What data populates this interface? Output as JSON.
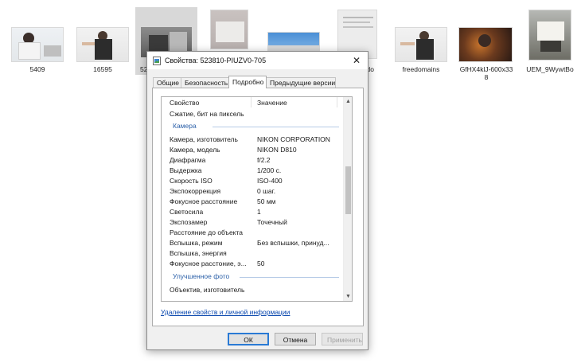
{
  "files": [
    {
      "name": "5409",
      "icon": "photo-thumbnail"
    },
    {
      "name": "16595",
      "icon": "photo-thumbnail"
    },
    {
      "name": "52",
      "icon": "photo-thumbnail"
    },
    {
      "name": "",
      "icon": "photo-thumbnail"
    },
    {
      "name": "",
      "icon": "photo-thumbnail"
    },
    {
      "name": "do",
      "icon": "photo-thumbnail"
    },
    {
      "name": "freedomains",
      "icon": "photo-thumbnail"
    },
    {
      "name": "GfHX4klJ-600x33\n8",
      "icon": "photo-thumbnail"
    },
    {
      "name": "UEM_9WywtBo",
      "icon": "photo-thumbnail"
    }
  ],
  "dialog": {
    "title": "Свойства: 523810-PIUZV0-705",
    "icon": "image-file-icon",
    "close_symbol": "✕",
    "tabs": [
      {
        "label": "Общие",
        "active": false
      },
      {
        "label": "Безопасность",
        "active": false
      },
      {
        "label": "Подробно",
        "active": true
      },
      {
        "label": "Предыдущие версии",
        "active": false
      }
    ],
    "columns": {
      "property": "Свойство",
      "value": "Значение"
    },
    "rows": [
      {
        "type": "row",
        "key": "Сжатие, бит на пиксель",
        "value": ""
      },
      {
        "type": "group",
        "label": "Камера"
      },
      {
        "type": "row",
        "key": "Камера, изготовитель",
        "value": "NIKON CORPORATION"
      },
      {
        "type": "row",
        "key": "Камера, модель",
        "value": "NIKON D810"
      },
      {
        "type": "row",
        "key": "Диафрагма",
        "value": "f/2.2"
      },
      {
        "type": "row",
        "key": "Выдержка",
        "value": "1/200 с."
      },
      {
        "type": "row",
        "key": "Скорость ISO",
        "value": "ISO-400"
      },
      {
        "type": "row",
        "key": "Экспокоррекция",
        "value": "0 шаг."
      },
      {
        "type": "row",
        "key": "Фокусное расстояние",
        "value": "50 мм"
      },
      {
        "type": "row",
        "key": "Светосила",
        "value": "1"
      },
      {
        "type": "row",
        "key": "Экспозамер",
        "value": "Точечный"
      },
      {
        "type": "row",
        "key": "Расстояние до объекта",
        "value": ""
      },
      {
        "type": "row",
        "key": "Вспышка, режим",
        "value": "Без вспышки, принуд..."
      },
      {
        "type": "row",
        "key": "Вспышка, энергия",
        "value": ""
      },
      {
        "type": "row",
        "key": "Фокусное расстоние, э...",
        "value": "50"
      },
      {
        "type": "group",
        "label": "Улучшенное фото"
      },
      {
        "type": "row",
        "key": "Объектив, изготовитель",
        "value": ""
      }
    ],
    "remove_link": "Удаление свойств и личной информации",
    "buttons": {
      "ok": "ОК",
      "cancel": "Отмена",
      "apply": "Применить"
    },
    "colors": {
      "group_header": "#2a5fa8",
      "link": "#0645ad",
      "ok_border": "#2a7ad5"
    }
  }
}
